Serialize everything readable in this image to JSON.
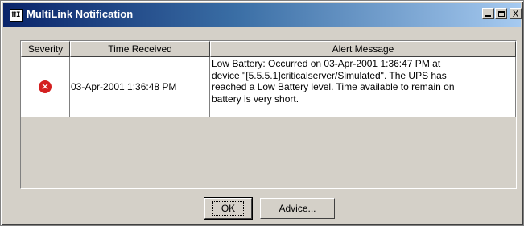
{
  "window": {
    "title": "MultiLink Notification",
    "icon": "app-icon",
    "controls": [
      "minimize-icon",
      "maximize-icon",
      "close-icon"
    ],
    "close_glyph": "X"
  },
  "table": {
    "columns": [
      "Severity",
      "Time Received",
      "Alert Message"
    ],
    "rows": [
      {
        "severity_icon": "error-icon",
        "severity_color": "#d42020",
        "time_received": "03-Apr-2001 1:36:48 PM",
        "alert_message_lines": [
          "Low Battery: Occurred on 03-Apr-2001 1:36:47 PM at",
          "device \"[5.5.5.1]criticalserver/Simulated\". The UPS has",
          "reached a Low Battery level.  Time available to remain on",
          "battery is very short."
        ]
      }
    ]
  },
  "buttons": {
    "ok_label": "OK",
    "advice_label": "Advice..."
  },
  "colors": {
    "titlebar_start": "#0a246a",
    "titlebar_end": "#a6caf0",
    "face": "#d4d0c8"
  }
}
